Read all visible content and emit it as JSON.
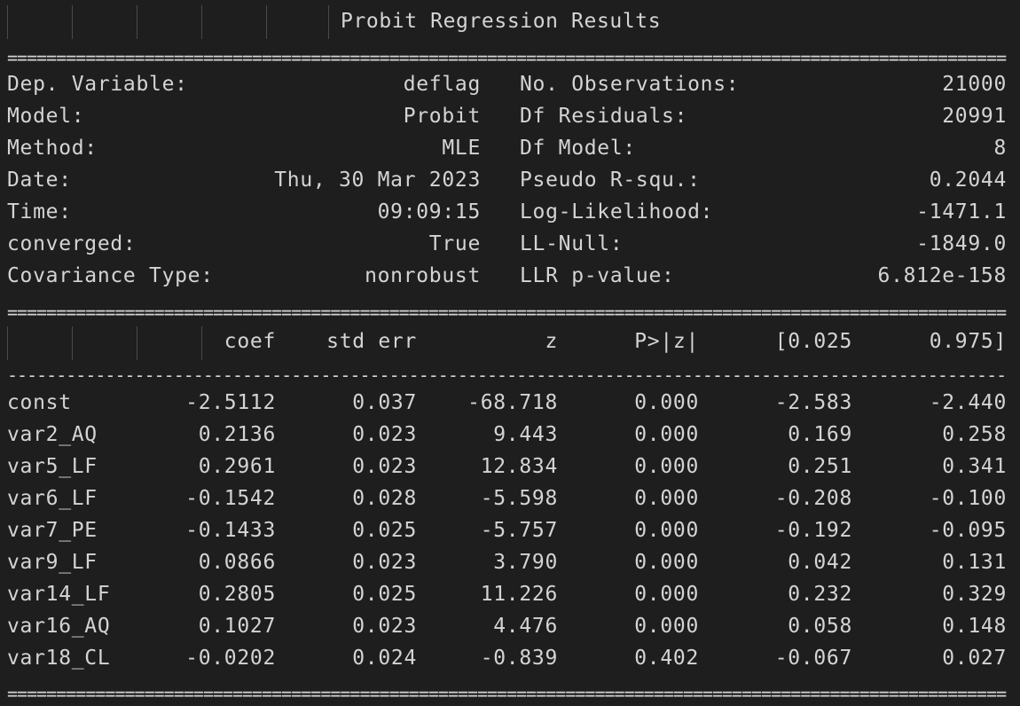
{
  "title": "Probit Regression Results",
  "summary": [
    {
      "label": "Dep. Variable:",
      "value": "deflag",
      "label2": "No. Observations:",
      "value2": "21000"
    },
    {
      "label": "Model:",
      "value": "Probit",
      "label2": "Df Residuals:",
      "value2": "20991"
    },
    {
      "label": "Method:",
      "value": "MLE",
      "label2": "Df Model:",
      "value2": "8"
    },
    {
      "label": "Date:",
      "value": "Thu, 30 Mar 2023",
      "label2": "Pseudo R-squ.:",
      "value2": "0.2044"
    },
    {
      "label": "Time:",
      "value": "09:09:15",
      "label2": "Log-Likelihood:",
      "value2": "-1471.1"
    },
    {
      "label": "converged:",
      "value": "True",
      "label2": "LL-Null:",
      "value2": "-1849.0"
    },
    {
      "label": "Covariance Type:",
      "value": "nonrobust",
      "label2": "LLR p-value:",
      "value2": "6.812e-158"
    }
  ],
  "columns": [
    "coef",
    "std err",
    "z",
    "P>|z|",
    "[0.025",
    "0.975]"
  ],
  "rows": [
    {
      "name": "const",
      "coef": "-2.5112",
      "se": "0.037",
      "z": "-68.718",
      "p": "0.000",
      "lo": "-2.583",
      "hi": "-2.440"
    },
    {
      "name": "var2_AQ",
      "coef": "0.2136",
      "se": "0.023",
      "z": "9.443",
      "p": "0.000",
      "lo": "0.169",
      "hi": "0.258"
    },
    {
      "name": "var5_LF",
      "coef": "0.2961",
      "se": "0.023",
      "z": "12.834",
      "p": "0.000",
      "lo": "0.251",
      "hi": "0.341"
    },
    {
      "name": "var6_LF",
      "coef": "-0.1542",
      "se": "0.028",
      "z": "-5.598",
      "p": "0.000",
      "lo": "-0.208",
      "hi": "-0.100"
    },
    {
      "name": "var7_PE",
      "coef": "-0.1433",
      "se": "0.025",
      "z": "-5.757",
      "p": "0.000",
      "lo": "-0.192",
      "hi": "-0.095"
    },
    {
      "name": "var9_LF",
      "coef": "0.0866",
      "se": "0.023",
      "z": "3.790",
      "p": "0.000",
      "lo": "0.042",
      "hi": "0.131"
    },
    {
      "name": "var14_LF",
      "coef": "0.2805",
      "se": "0.025",
      "z": "11.226",
      "p": "0.000",
      "lo": "0.232",
      "hi": "0.329"
    },
    {
      "name": "var16_AQ",
      "coef": "0.1027",
      "se": "0.023",
      "z": "4.476",
      "p": "0.000",
      "lo": "0.058",
      "hi": "0.148"
    },
    {
      "name": "var18_CL",
      "coef": "-0.0202",
      "se": "0.024",
      "z": "-0.839",
      "p": "0.402",
      "lo": "-0.067",
      "hi": "0.027"
    }
  ]
}
